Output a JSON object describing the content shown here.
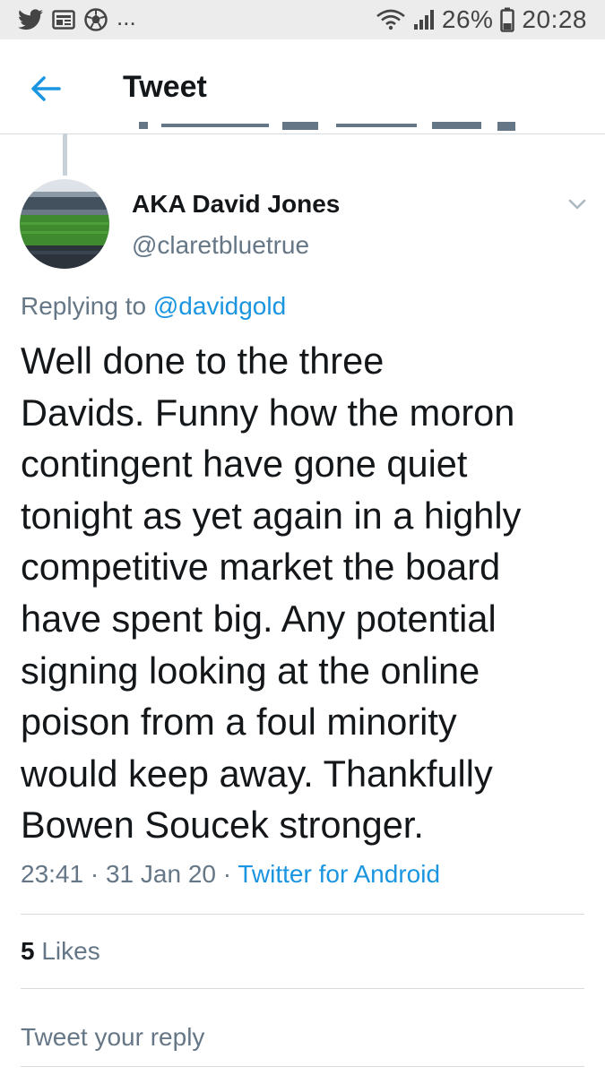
{
  "status_bar": {
    "left_icons": [
      "twitter-bird-icon",
      "news-app-icon",
      "football-icon"
    ],
    "overflow": "...",
    "battery": "26%",
    "time": "20:28"
  },
  "header": {
    "back_icon": "arrow-left-icon",
    "title": "Tweet"
  },
  "tweet": {
    "author_name": "AKA David Jones",
    "author_handle": "@claretbluetrue",
    "replying_prefix": "Replying to",
    "replying_to": "@davidgold",
    "lines": [
      "Well done to the three",
      "Davids. Funny how the moron",
      "contingent have gone quiet",
      "tonight as yet again in a highly",
      "competitive market the board",
      "have spent big. Any potential",
      "signing looking at the online",
      "poison from a foul minority",
      "would keep away. Thankfully",
      "Bowen Soucek stronger."
    ],
    "time": "23:41",
    "date": "31 Jan 20",
    "source": "Twitter for Android",
    "likes_count": "5",
    "likes_label": "Likes"
  },
  "reply": {
    "placeholder": "Tweet your reply"
  },
  "colors": {
    "accent": "#1b95e0",
    "secondary_text": "#657786",
    "primary_text": "#14171a",
    "divider": "#d6dbe0",
    "status_bar_bg": "#ececec"
  }
}
